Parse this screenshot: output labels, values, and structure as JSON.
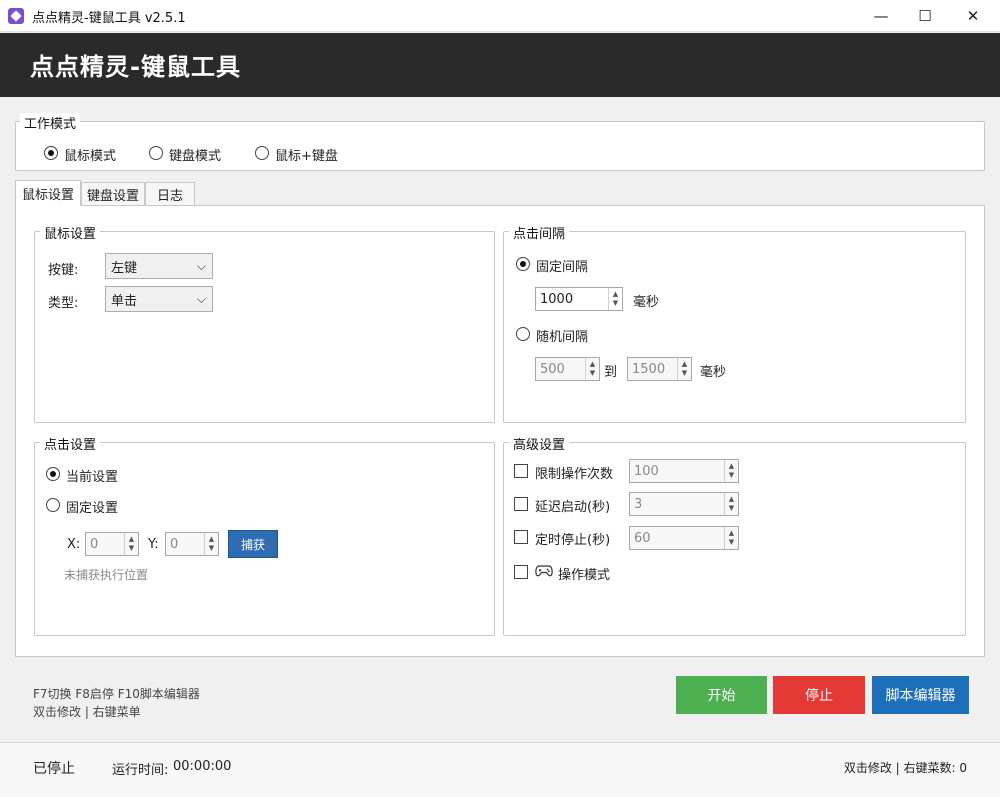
{
  "window": {
    "title": "点点精灵-键鼠工具 v2.5.1",
    "minimize": "—",
    "maximize": "☐",
    "close": "✕"
  },
  "banner": {
    "title": "点点精灵-键鼠工具"
  },
  "work_mode": {
    "label": "工作模式",
    "options": [
      {
        "label": "鼠标模式",
        "selected": true
      },
      {
        "label": "键盘模式",
        "selected": false
      },
      {
        "label": "鼠标+键盘",
        "selected": false
      }
    ]
  },
  "tabs": [
    {
      "label": "鼠标设置",
      "active": true
    },
    {
      "label": "键盘设置",
      "active": false
    },
    {
      "label": "日志",
      "active": false
    }
  ],
  "mouse_settings": {
    "label": "鼠标设置",
    "button_label": "按键:",
    "button_value": "左键",
    "type_label": "类型:",
    "type_value": "单击"
  },
  "click_interval": {
    "label": "点击间隔",
    "fixed_label": "固定间隔",
    "fixed_value": "1000",
    "fixed_unit": "毫秒",
    "random_label": "随机间隔",
    "random_min": "500",
    "random_to": "到",
    "random_max": "1500",
    "random_unit": "毫秒"
  },
  "click_settings": {
    "label": "点击设置",
    "current_label": "当前设置",
    "fixed_label": "固定设置",
    "x_label": "X:",
    "x_value": "0",
    "y_label": "Y:",
    "y_value": "0",
    "capture_label": "捕获",
    "status": "未捕获执行位置"
  },
  "advanced": {
    "label": "高级设置",
    "limit_label": "限制操作次数",
    "limit_value": "100",
    "delay_label": "延迟启动(秒)",
    "delay_value": "3",
    "timer_label": "定时停止(秒)",
    "timer_value": "60",
    "gamepad_label": "操作模式"
  },
  "hotkeys": {
    "line1": "F7切换 F8启停 F10脚本编辑器",
    "line2": "双击修改 | 右键菜单"
  },
  "buttons": {
    "start": "开始",
    "stop": "停止",
    "script_editor": "脚本编辑器"
  },
  "status_bar": {
    "state": "已停止",
    "runtime_label": "运行时间:",
    "runtime_value": "00:00:00",
    "right_text": "双击修改 | 右键菜数: 0"
  },
  "colors": {
    "start": "#4caf50",
    "stop": "#e53935",
    "script_editor": "#1e6fba",
    "banner": "#2a2a2a",
    "capture": "#2e6db4"
  }
}
